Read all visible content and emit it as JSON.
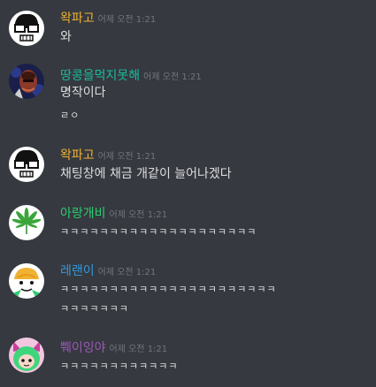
{
  "messages": [
    {
      "author": "왁파고",
      "author_color": "#f0b232",
      "time": "어제 오전 1:21",
      "avatar_icon": "glasses-face-icon",
      "lines": [
        "와"
      ]
    },
    {
      "author": "땅콩을먹지못해",
      "author_color": "#1abc9c",
      "time": "어제 오전 1:21",
      "avatar_icon": "dark-portrait-icon",
      "lines": [
        "명작이다",
        "ㄹㅇ"
      ]
    },
    {
      "author": "왁파고",
      "author_color": "#f0b232",
      "time": "어제 오전 1:21",
      "avatar_icon": "glasses-face-icon",
      "lines": [
        "채팅창에 채금 개같이 늘어나겠다"
      ]
    },
    {
      "author": "아랑개비",
      "author_color": "#2ecc71",
      "time": "어제 오전 1:21",
      "avatar_icon": "leaf-icon",
      "lines": [
        "ㅋㅋㅋㅋㅋㅋㅋㅋㅋㅋㅋㅋㅋㅋㅋㅋㅋㅋㅋㅋ"
      ]
    },
    {
      "author": "레랜이",
      "author_color": "#3498db",
      "time": "어제 오전 1:21",
      "avatar_icon": "cartoon-face-icon",
      "lines": [
        "ㅋㅋㅋㅋㅋㅋㅋㅋㅋㅋㅋㅋㅋㅋㅋㅋㅋㅋㅋㅋㅋㅋ",
        "ㅋㅋㅋㅋㅋㅋㅋ"
      ]
    },
    {
      "author": "쀄이잉야",
      "author_color": "#9b59b6",
      "time": "어제 오전 1:21",
      "avatar_icon": "cat-girl-icon",
      "lines": [
        "ㅋㅋㅋㅋㅋㅋㅋㅋㅋㅋㅋㅋ"
      ]
    }
  ]
}
